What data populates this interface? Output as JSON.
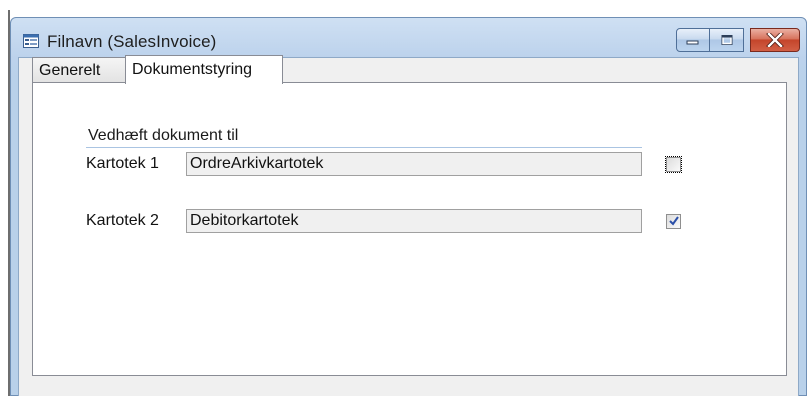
{
  "window": {
    "title": "Filnavn (SalesInvoice)",
    "icon": "form-icon",
    "buttons": {
      "minimize": "minimize-icon",
      "maximize": "maximize-icon",
      "close": "close-icon"
    }
  },
  "tabs": [
    {
      "label": "Generelt",
      "active": false
    },
    {
      "label": "Dokumentstyring",
      "active": true
    }
  ],
  "group": {
    "label": "Vedhæft dokument til"
  },
  "fields": [
    {
      "label": "Kartotek 1",
      "value": "OrdreArkivkartotek",
      "checked": false
    },
    {
      "label": "Kartotek 2",
      "value": "Debitorkartotek",
      "checked": true
    }
  ],
  "colors": {
    "title_bar": "#bcd2ec",
    "close_button": "#c4452b",
    "check_mark": "#2b4fa8"
  }
}
